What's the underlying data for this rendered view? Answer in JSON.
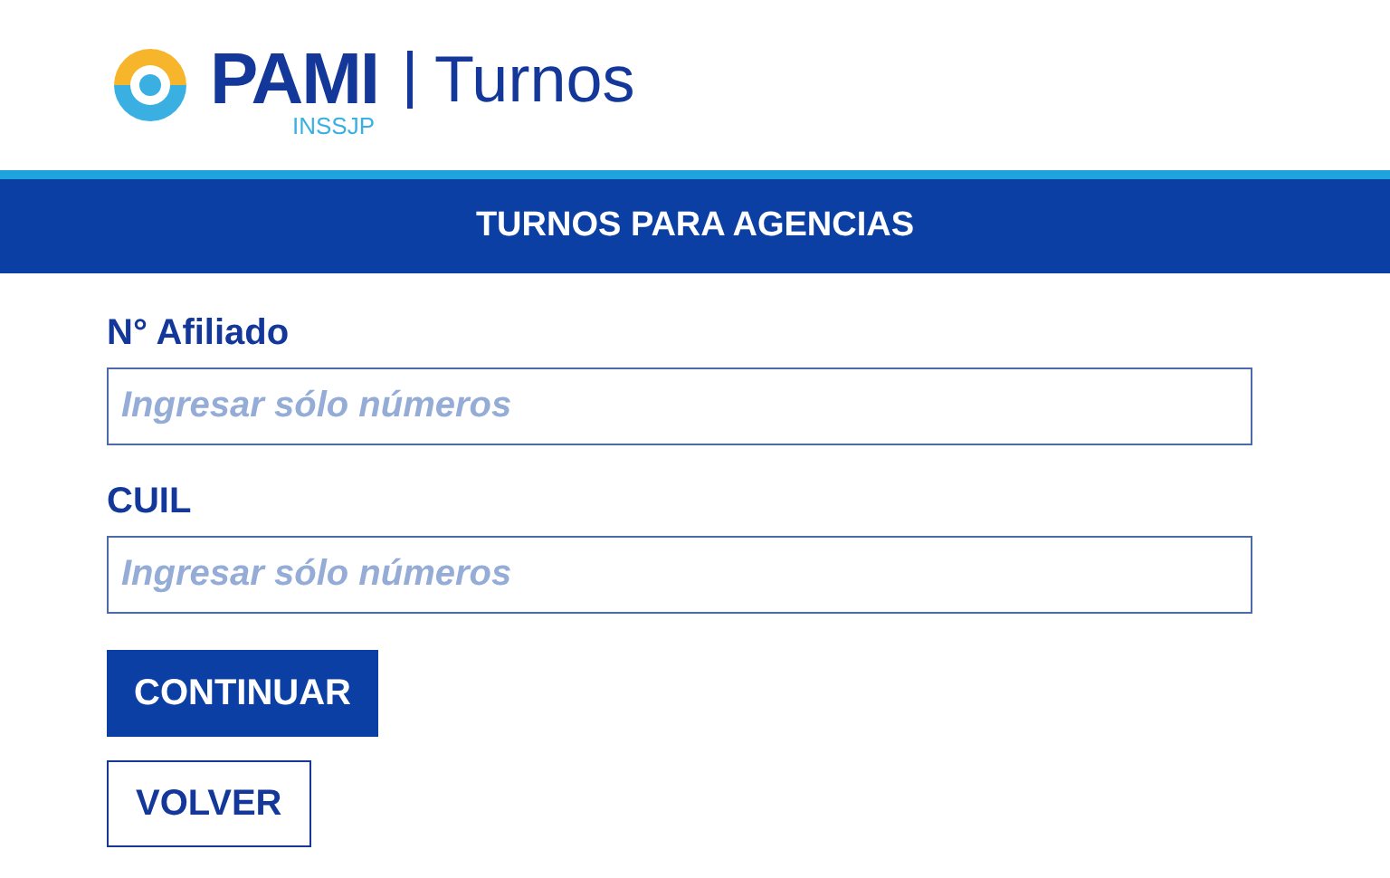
{
  "header": {
    "brand": "PAMI",
    "brand_subtitle": "INSSJP",
    "section": "Turnos"
  },
  "banner": {
    "title": "TURNOS PARA AGENCIAS"
  },
  "fields": [
    {
      "label": "N° Afiliado",
      "placeholder": "Ingresar sólo números"
    },
    {
      "label": "CUIL",
      "placeholder": "Ingresar sólo números"
    }
  ],
  "buttons": [
    {
      "label": "CONTINUAR",
      "kind": "primary"
    },
    {
      "label": "VOLVER",
      "kind": "outline"
    }
  ]
}
